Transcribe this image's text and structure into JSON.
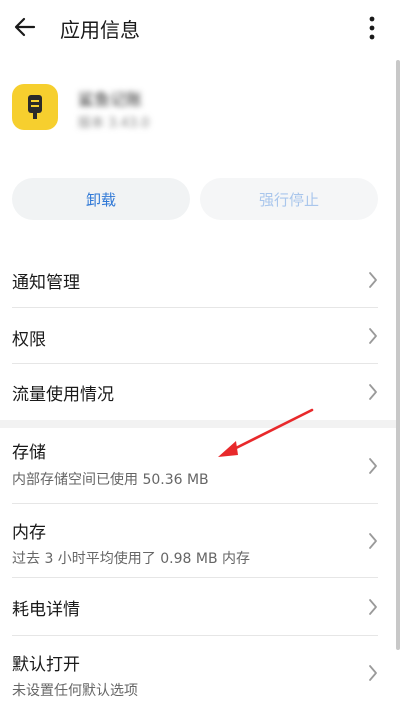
{
  "header": {
    "title": "应用信息",
    "back_icon": "arrow-left-icon",
    "more_icon": "more-vertical-icon"
  },
  "app": {
    "name": "鲨鱼记账",
    "version": "版本 3.43.0",
    "icon_color": "#f6cf2e"
  },
  "actions": {
    "uninstall_label": "卸载",
    "force_stop_label": "强行停止"
  },
  "settings": {
    "items": [
      {
        "label": "通知管理"
      },
      {
        "label": "权限"
      },
      {
        "label": "流量使用情况"
      },
      {
        "label": "存储",
        "subtitle": "内部存储空间已使用 50.36 MB"
      },
      {
        "label": "内存",
        "subtitle": "过去 3 小时平均使用了 0.98 MB 内存"
      },
      {
        "label": "耗电详情"
      },
      {
        "label": "默认打开",
        "subtitle": "未设置任何默认选项"
      }
    ]
  },
  "colors": {
    "accent": "#2f78d6",
    "disabled_accent": "#a9c6ec",
    "annotation_arrow": "#e8292b"
  }
}
